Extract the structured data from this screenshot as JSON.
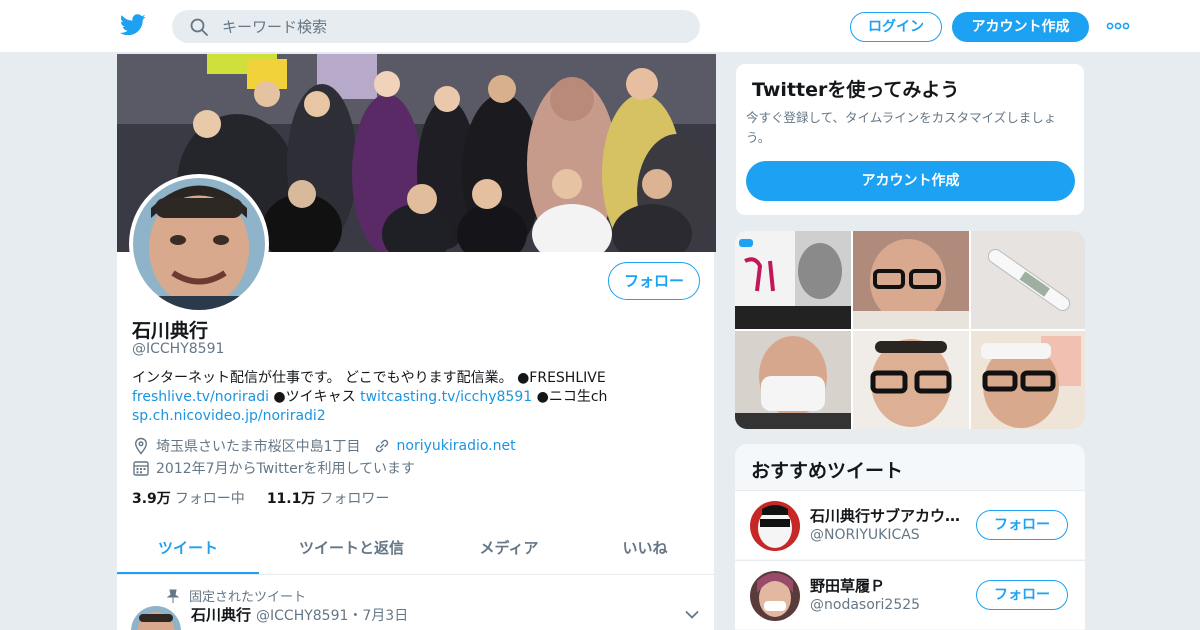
{
  "header": {
    "search_placeholder": "キーワード検索",
    "login_label": "ログイン",
    "signup_label": "アカウント作成",
    "brand_color": "#1da1f2"
  },
  "profile": {
    "name": "石川典行",
    "handle": "@ICCHY8591",
    "follow_label": "フォロー",
    "bio": {
      "line1": "インターネット配信が仕事です。 どこでもやります配信業。 ●FRESHLIVE",
      "link1": "freshlive.tv/noriradi",
      "text2": " ●ツイキャス ",
      "link2": "twitcasting.tv/icchy8591",
      "text3": " ●ニコ生ch",
      "link3": "sp.ch.nicovideo.jp/noriradi2"
    },
    "location": "埼玉県さいたま市桜区中島1丁目",
    "website": "noriyukiradio.net",
    "joined": "2012年7月からTwitterを利用しています",
    "following_count": "3.9万",
    "following_label": "フォロー中",
    "followers_count": "11.1万",
    "followers_label": "フォロワー"
  },
  "tabs": [
    {
      "label": "ツイート",
      "active": true
    },
    {
      "label": "ツイートと返信",
      "active": false
    },
    {
      "label": "メディア",
      "active": false
    },
    {
      "label": "いいね",
      "active": false
    }
  ],
  "pinned_tweet": {
    "pinned_label": "固定されたツイート",
    "author_name": "石川典行",
    "author_meta": "@ICCHY8591・7月3日"
  },
  "sidebar": {
    "signup_card": {
      "title": "Twitterを使ってみよう",
      "text": "今すぐ登録して、タイムラインをカスタマイズしましょう。",
      "button_label": "アカウント作成"
    },
    "recommendations": {
      "title": "おすすめツイート",
      "items": [
        {
          "name": "石川典行サブアカウ…",
          "handle": "@NORIYUKICAS",
          "follow_label": "フォロー"
        },
        {
          "name": "野田草履Ｐ",
          "handle": "@nodasori2525",
          "follow_label": "フォロー"
        }
      ]
    }
  }
}
